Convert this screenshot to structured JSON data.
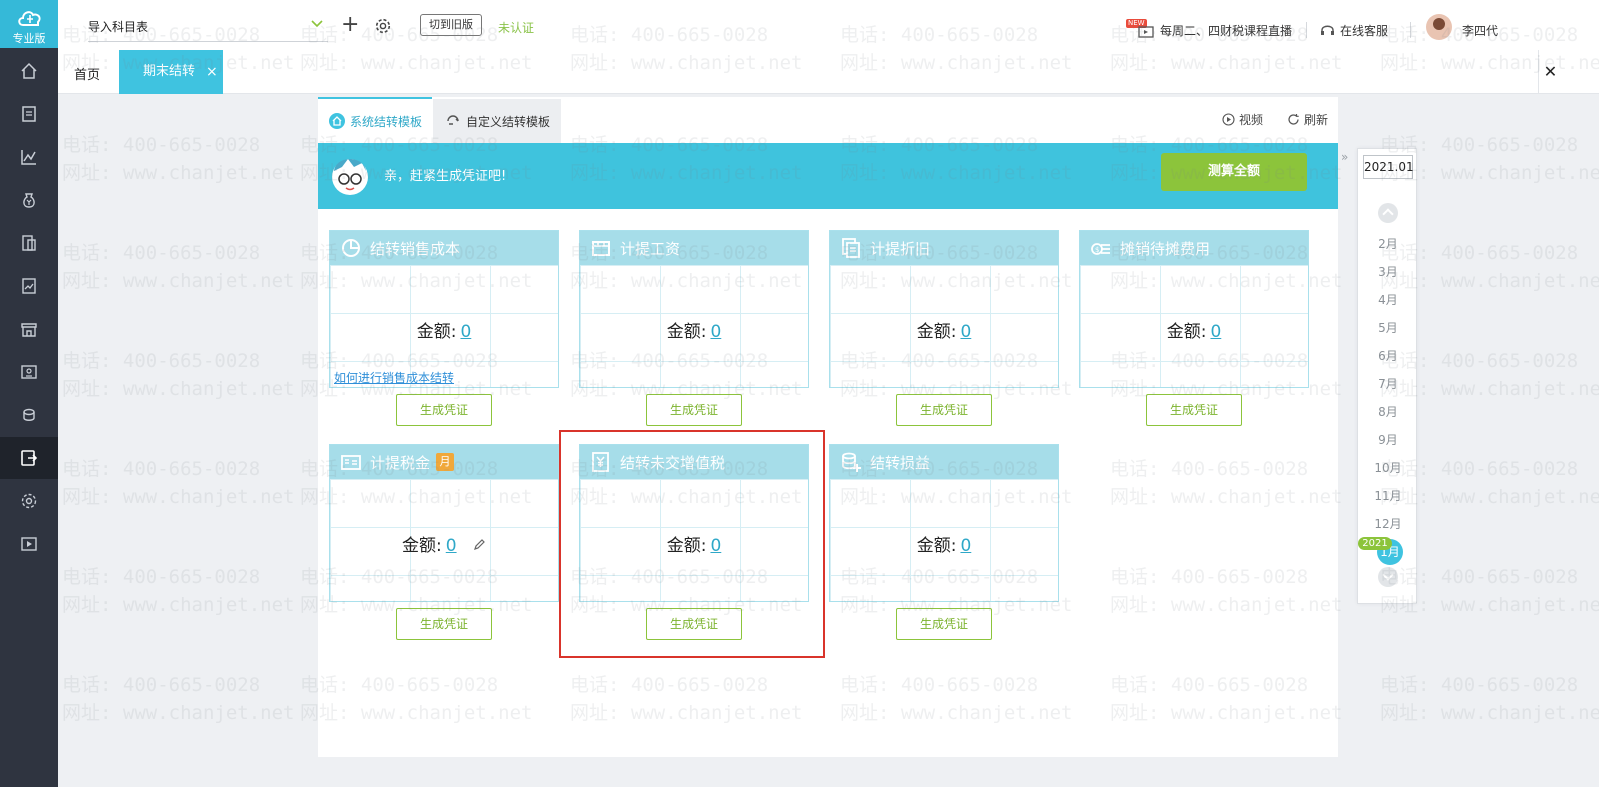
{
  "sidebar": {
    "edition": "专业版",
    "items": [
      {
        "icon": "home-icon"
      },
      {
        "icon": "voucher-icon"
      },
      {
        "icon": "chart-line-icon"
      },
      {
        "icon": "money-bag-icon"
      },
      {
        "icon": "ledger-icon"
      },
      {
        "icon": "report-icon"
      },
      {
        "icon": "store-icon"
      },
      {
        "icon": "cashier-icon"
      },
      {
        "icon": "coins-icon"
      },
      {
        "icon": "period-end-icon"
      },
      {
        "icon": "settings-icon"
      },
      {
        "icon": "video-icon"
      }
    ]
  },
  "topbar": {
    "account_name": "导入科目表",
    "old_version_label": "切到旧版",
    "cert_status": "未认证",
    "new_badge": "NEW",
    "live_label": "每周二、四财税课程直播",
    "service_label": "在线客服",
    "user_name": "李四代"
  },
  "tabs": {
    "home": "首页",
    "active": "期末结转",
    "close": "×"
  },
  "panel": {
    "tab_system": "系统结转模板",
    "tab_custom": "自定义结转模板",
    "video_label": "视频",
    "refresh_label": "刷新",
    "banner_text": "亲，赶紧生成凭证吧!",
    "calc_button": "测算全额"
  },
  "cards": [
    {
      "title": "结转销售成本",
      "amount_label": "金额:",
      "amount": "0",
      "help_link": "如何进行销售成本结转",
      "button": "生成凭证"
    },
    {
      "title": "计提工资",
      "amount_label": "金额:",
      "amount": "0",
      "button": "生成凭证"
    },
    {
      "title": "计提折旧",
      "amount_label": "金额:",
      "amount": "0",
      "button": "生成凭证"
    },
    {
      "title": "摊销待摊费用",
      "amount_label": "金额:",
      "amount": "0",
      "button": "生成凭证"
    },
    {
      "title": "计提税金",
      "badge": "月",
      "amount_label": "金额:",
      "amount": "0",
      "button": "生成凭证"
    },
    {
      "title": "结转未交增值税",
      "amount_label": "金额:",
      "amount": "0",
      "button": "生成凭证"
    },
    {
      "title": "结转损益",
      "amount_label": "金额:",
      "amount": "0",
      "button": "生成凭证"
    }
  ],
  "months": {
    "current_period": "2021.01",
    "list": [
      "2月",
      "3月",
      "4月",
      "5月",
      "6月",
      "7月",
      "8月",
      "9月",
      "10月",
      "11月",
      "12月"
    ],
    "year_tag": "2021",
    "current_month": "1月"
  },
  "watermark": {
    "phone": "电话: 400-665-0028",
    "site": "网址: www.chanjet.net"
  },
  "colors": {
    "accent": "#3fc3e0",
    "green": "#8cc43b",
    "rail": "#2f3440",
    "highlight": "#d9342b"
  }
}
